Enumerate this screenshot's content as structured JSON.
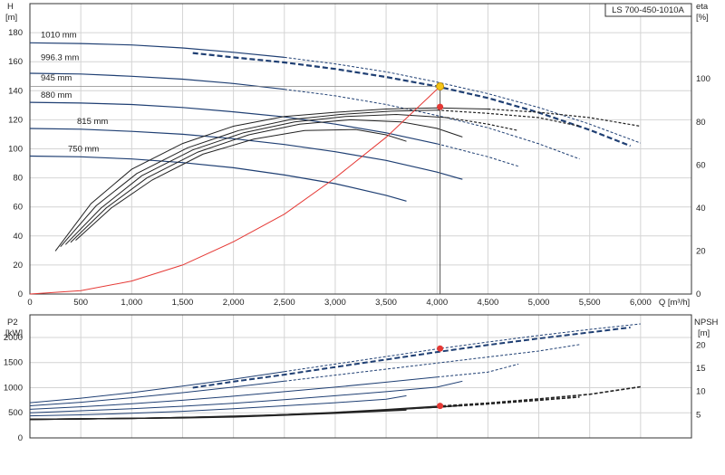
{
  "chart_data": [
    {
      "type": "line",
      "model": "LS 700-450-1010A",
      "xlabel": "Q [m³/h]",
      "ylabel_left": "H",
      "ylabel_left_unit": "[m]",
      "ylabel_right": "eta",
      "ylabel_right_unit": "[%]",
      "xlim": [
        0,
        6500
      ],
      "ylim_left": [
        0,
        200
      ],
      "ylim_right": [
        0,
        135
      ],
      "x_ticks": [
        0,
        500,
        1000,
        1500,
        2000,
        2500,
        3000,
        3500,
        4000,
        4500,
        5000,
        5500,
        6000
      ],
      "x_tick_labels": [
        "0",
        "500",
        "1,000",
        "1,500",
        "2,000",
        "2,500",
        "3,000",
        "3,500",
        "4,000",
        "4,500",
        "5,000",
        "5,500",
        "6,000"
      ],
      "y_left_ticks": [
        0,
        20,
        40,
        60,
        80,
        100,
        120,
        140,
        160,
        180
      ],
      "y_right_ticks": [
        0,
        20,
        40,
        60,
        80,
        100
      ],
      "grid": true,
      "head_curves": [
        {
          "name": "1010 mm",
          "x": [
            0,
            500,
            1000,
            1500,
            2000,
            2500,
            3000,
            3500,
            4000,
            4500,
            5000,
            5500,
            6000
          ],
          "y": [
            173,
            172.5,
            171.5,
            169.5,
            166.5,
            163,
            158.5,
            153,
            146,
            138,
            128.5,
            117,
            104
          ],
          "solid_until": 2500
        },
        {
          "name": "996.3 mm",
          "x": [
            1600,
            2000,
            2500,
            3000,
            3500,
            4000,
            4500,
            5000,
            5500,
            5900
          ],
          "y": [
            166,
            163,
            159.5,
            155,
            149.5,
            143,
            135,
            125,
            113,
            102
          ],
          "solid_until": 1600,
          "selected": true
        },
        {
          "name": "945 mm",
          "x": [
            0,
            500,
            1000,
            1500,
            2000,
            2500,
            3000,
            3500,
            4000,
            4500,
            5000,
            5400
          ],
          "y": [
            152,
            151.5,
            150,
            148,
            145,
            141,
            136.5,
            130.5,
            123,
            114.5,
            103.5,
            93
          ],
          "solid_until": 2500
        },
        {
          "name": "880 mm",
          "x": [
            0,
            500,
            1000,
            1500,
            2000,
            2500,
            3000,
            3500,
            4000,
            4500,
            4800
          ],
          "y": [
            132,
            131.5,
            130.5,
            128.5,
            125.5,
            122,
            117,
            111,
            103.5,
            94.5,
            88
          ],
          "solid_until": 4000
        },
        {
          "name": "815 mm",
          "x": [
            0,
            500,
            1000,
            1500,
            2000,
            2500,
            3000,
            3500,
            4000,
            4250
          ],
          "y": [
            114,
            113.5,
            112,
            110,
            107,
            103,
            98,
            92,
            84,
            79
          ],
          "solid_until": 4250
        },
        {
          "name": "750 mm",
          "x": [
            0,
            500,
            1000,
            1500,
            2000,
            2500,
            3000,
            3500,
            3700
          ],
          "y": [
            95,
            94.5,
            93,
            90.5,
            87,
            82,
            76,
            68,
            64
          ],
          "solid_until": 3700
        }
      ],
      "eta_curves": [
        {
          "x": [
            250,
            600,
            1000,
            1500,
            2000,
            2500,
            3000,
            3500,
            4000,
            4500,
            5000,
            5500,
            6000
          ],
          "y": [
            20,
            42,
            58,
            70,
            78,
            82.5,
            84.5,
            86,
            86.5,
            86,
            84.5,
            82,
            78
          ],
          "solid_until": 4500
        },
        {
          "x": [
            300,
            650,
            1050,
            1550,
            2050,
            2550,
            3050,
            3550,
            4000,
            4500,
            5000,
            5400
          ],
          "y": [
            22,
            41,
            56,
            68,
            76,
            81,
            83.5,
            85,
            85.5,
            84,
            82,
            78
          ],
          "solid_until": 4000
        },
        {
          "x": [
            350,
            700,
            1100,
            1600,
            2100,
            2600,
            3100,
            3600,
            4100,
            4500,
            4800
          ],
          "y": [
            23,
            40,
            55,
            67,
            75,
            80,
            82.5,
            83.5,
            82,
            79,
            76
          ],
          "solid_until": 4100
        },
        {
          "x": [
            400,
            750,
            1150,
            1650,
            2150,
            2650,
            3150,
            3650,
            4000,
            4250
          ],
          "y": [
            24,
            40,
            54,
            66,
            74,
            79,
            81,
            80,
            77,
            73
          ],
          "solid_until": 4250
        },
        {
          "x": [
            450,
            800,
            1200,
            1700,
            2200,
            2700,
            3200,
            3500,
            3700
          ],
          "y": [
            25,
            40,
            53,
            65,
            72,
            76,
            76.5,
            74,
            71
          ],
          "solid_until": 3700
        }
      ],
      "system_curve": {
        "x": [
          0,
          500,
          1000,
          1500,
          2000,
          2500,
          3000,
          3500,
          4030
        ],
        "y": [
          0,
          2.3,
          9,
          20,
          36,
          55,
          80,
          108,
          143
        ]
      },
      "duty_point": {
        "q": 4030,
        "h": 143,
        "eta": 87
      }
    },
    {
      "type": "line",
      "ylabel_left": "P2",
      "ylabel_left_unit": "[kW]",
      "ylabel_right": "NPSH",
      "ylabel_right_unit": "[m]",
      "xlim": [
        0,
        6500
      ],
      "ylim_left": [
        0,
        2450
      ],
      "ylim_right": [
        0,
        26.5
      ],
      "y_left_ticks": [
        0,
        500,
        1000,
        1500,
        2000
      ],
      "y_right_ticks": [
        5,
        10,
        15,
        20
      ],
      "grid": true,
      "power_curves": [
        {
          "x": [
            0,
            500,
            1000,
            1500,
            2000,
            2500,
            3000,
            3500,
            4000,
            4500,
            5000,
            5500,
            6000
          ],
          "y": [
            700,
            790,
            900,
            1030,
            1170,
            1320,
            1470,
            1620,
            1770,
            1910,
            2040,
            2160,
            2270
          ],
          "solid_until": 2500
        },
        {
          "x": [
            1600,
            2000,
            2500,
            3000,
            3500,
            4000,
            4500,
            5000,
            5500,
            5900
          ],
          "y": [
            1000,
            1120,
            1260,
            1410,
            1560,
            1710,
            1850,
            1980,
            2100,
            2200
          ],
          "solid_until": 1600,
          "selected": true
        },
        {
          "x": [
            0,
            500,
            1000,
            1500,
            2000,
            2500,
            3000,
            3500,
            4000,
            4500,
            5000,
            5400
          ],
          "y": [
            640,
            710,
            800,
            900,
            1010,
            1130,
            1250,
            1370,
            1490,
            1610,
            1730,
            1860
          ],
          "solid_until": 2500
        },
        {
          "x": [
            0,
            500,
            1000,
            1500,
            2000,
            2500,
            3000,
            3500,
            4000,
            4500,
            4800
          ],
          "y": [
            570,
            620,
            680,
            750,
            830,
            920,
            1010,
            1110,
            1210,
            1310,
            1470
          ],
          "solid_until": 4000
        },
        {
          "x": [
            0,
            500,
            1000,
            1500,
            2000,
            2500,
            3000,
            3500,
            4000,
            4250
          ],
          "y": [
            500,
            540,
            580,
            630,
            690,
            760,
            840,
            920,
            1010,
            1130
          ],
          "solid_until": 4250
        },
        {
          "x": [
            0,
            500,
            1000,
            1500,
            2000,
            2500,
            3000,
            3500,
            3700
          ],
          "y": [
            440,
            460,
            490,
            530,
            580,
            640,
            700,
            770,
            840
          ],
          "solid_until": 3700
        }
      ],
      "npsh_curves": [
        {
          "x": [
            0,
            500,
            1000,
            1500,
            2000,
            2500,
            3000,
            3500,
            4000,
            4500,
            5000,
            5500,
            6000
          ],
          "y": [
            4,
            4.1,
            4.2,
            4.4,
            4.7,
            5,
            5.5,
            6.1,
            6.8,
            7.5,
            8.4,
            9.4,
            11
          ],
          "solid_until": 4000
        },
        {
          "x": [
            0,
            500,
            1000,
            1500,
            2000,
            2500,
            3000,
            3500,
            4000,
            4500,
            5000,
            5400
          ],
          "y": [
            4,
            4.1,
            4.2,
            4.4,
            4.6,
            5,
            5.4,
            6,
            6.6,
            7.3,
            8.1,
            8.8
          ],
          "solid_until": 4000
        },
        {
          "x": [
            0,
            500,
            1000,
            1500,
            2000,
            2500,
            3000,
            3500,
            4000,
            4250
          ],
          "y": [
            4,
            4.1,
            4.2,
            4.4,
            4.6,
            5,
            5.4,
            6,
            6.6,
            7
          ],
          "solid_until": 4250
        },
        {
          "x": [
            0,
            500,
            1000,
            1500,
            2000,
            2500,
            3000,
            3500,
            3700
          ],
          "y": [
            4,
            4.1,
            4.2,
            4.3,
            4.5,
            4.9,
            5.3,
            5.8,
            6
          ],
          "solid_until": 3700
        }
      ],
      "duty_point": {
        "q": 4030,
        "p2": 1780,
        "npsh": 6.9
      }
    }
  ],
  "colors": {
    "head": "#1f3f73",
    "eta": "#222222",
    "system": "#e53935",
    "duty_marker": "#e53935",
    "op_marker": "#f5c518",
    "grid": "#d4d4d4",
    "axis": "#333333"
  }
}
